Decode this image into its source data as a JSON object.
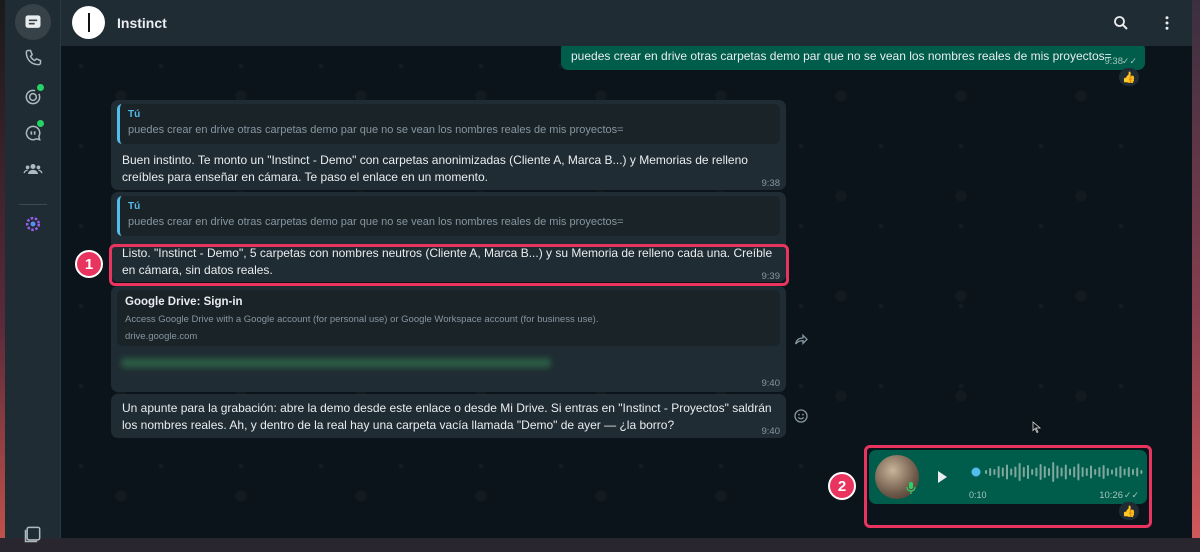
{
  "nav": {
    "items": [
      {
        "name": "chats",
        "active": true
      },
      {
        "name": "calls"
      },
      {
        "name": "status",
        "badge": true
      },
      {
        "name": "channels",
        "badge": true
      },
      {
        "name": "communities"
      },
      {
        "name": "meta-ai"
      }
    ]
  },
  "header": {
    "title": "Instinct"
  },
  "messages": {
    "m0": {
      "text": "puedes crear en drive otras carpetas demo par que no se vean los nombres reales de mis proyectos=",
      "time": "9:38",
      "reaction": "👍"
    },
    "m1": {
      "quote_author": "Tú",
      "quote_text": "puedes crear en drive otras carpetas demo par que no se vean los nombres reales de mis proyectos=",
      "text": "Buen instinto. Te monto un \"Instinct - Demo\" con carpetas anonimizadas (Cliente A, Marca B...) y Memorias de relleno creíbles para enseñar en cámara. Te paso el enlace en un momento.",
      "time": "9:38"
    },
    "m2": {
      "quote_author": "Tú",
      "quote_text": "puedes crear en drive otras carpetas demo par que no se vean los nombres reales de mis proyectos=",
      "text": "Listo. \"Instinct - Demo\", 5 carpetas con nombres neutros (Cliente A, Marca B...) y su Memoria de relleno cada una. Creíble en cámara, sin datos reales.",
      "time": "9:39"
    },
    "m3": {
      "link_title": "Google Drive: Sign-in",
      "link_desc": "Access Google Drive with a Google account (for personal use) or Google Workspace account (for business use).",
      "link_url": "drive.google.com",
      "time": "9:40"
    },
    "m4": {
      "text": "Un apunte para la grabación: abre la demo desde este enlace o desde Mi Drive. Si entras en \"Instinct - Proyectos\" saldrán los nombres reales. Ah, y dentro de la real hay una carpeta vacía llamada \"Demo\" de ayer — ¿la borro?",
      "time": "9:40"
    },
    "m5": {
      "duration": "0:10",
      "time": "10:26",
      "reaction": "👍"
    }
  },
  "annotations": {
    "a1": "1",
    "a2": "2"
  },
  "colors": {
    "accent": "#e8345f",
    "outgoing": "#005c4b",
    "incoming": "#202c33",
    "tick": "#53bdeb"
  }
}
